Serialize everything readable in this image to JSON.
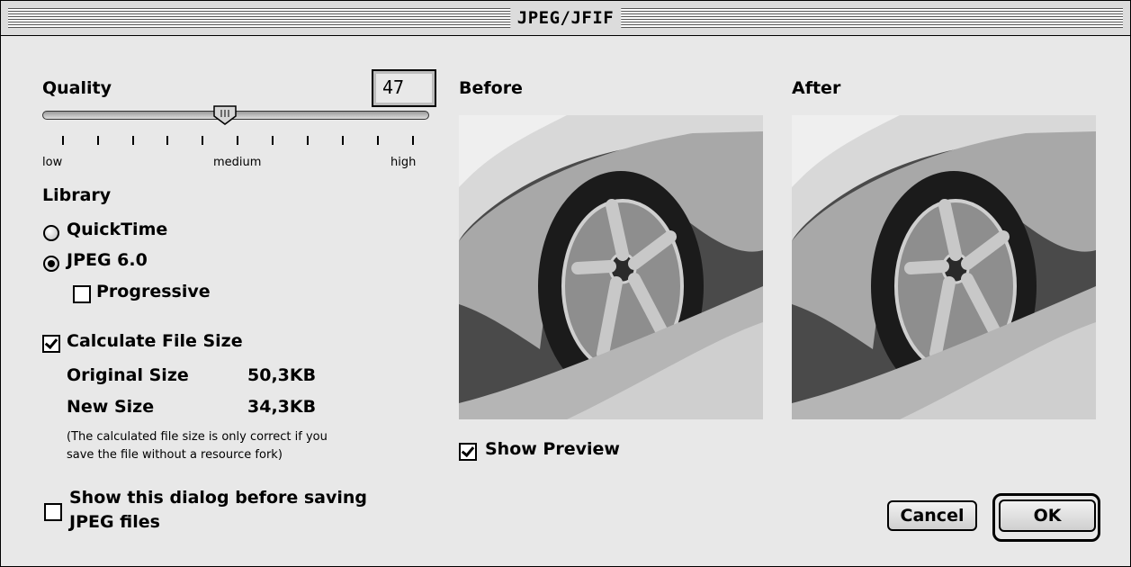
{
  "window": {
    "title": "JPEG/JFIF"
  },
  "quality": {
    "label": "Quality",
    "value": "47",
    "level_percent": 47,
    "scale_labels": {
      "low": "low",
      "medium": "medium",
      "high": "high"
    }
  },
  "library": {
    "label": "Library",
    "options": [
      {
        "label": "QuickTime",
        "selected": false
      },
      {
        "label": "JPEG 6.0",
        "selected": true
      }
    ],
    "progressive": {
      "label": "Progressive",
      "checked": false
    }
  },
  "file_size": {
    "label": "Calculate File Size",
    "checked": true,
    "original": {
      "label": "Original Size",
      "value": "50,3KB"
    },
    "new": {
      "label": "New Size",
      "value": "34,3KB"
    },
    "note_line1": "(The calculated file size is only correct if you",
    "note_line2": "save the file without a resource fork)"
  },
  "show_dialog": {
    "line1": "Show this dialog before saving",
    "line2": "JPEG files",
    "checked": false
  },
  "preview": {
    "before_label": "Before",
    "after_label": "After",
    "show_preview_label": "Show Preview",
    "show_preview_checked": true
  },
  "buttons": {
    "cancel": "Cancel",
    "ok": "OK"
  },
  "icons": {
    "thumb": "slider-thumb-icon",
    "wheel_photo": "car-wheel-photo"
  }
}
